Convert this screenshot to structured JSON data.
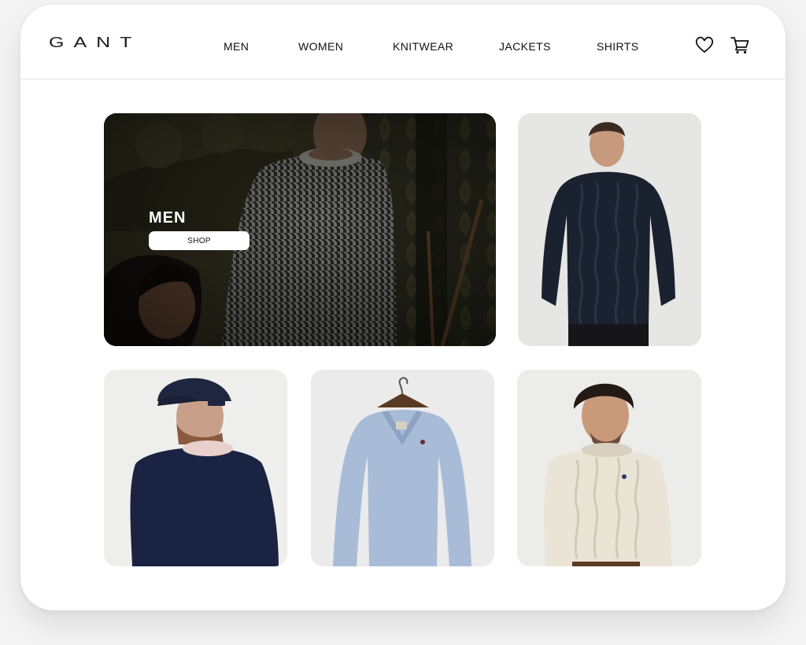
{
  "brand": {
    "logo": "GANT"
  },
  "nav": {
    "items": [
      "MEN",
      "WOMEN",
      "KNITWEAR",
      "JACKETS",
      "SHIRTS"
    ]
  },
  "header_icons": [
    "heart-icon",
    "cart-icon"
  ],
  "hero": {
    "title": "MEN",
    "button_label": "SHOP"
  },
  "products": [
    {
      "image": "man-back-dark-cable-knit-sweater"
    },
    {
      "image": "man-navy-sweater-with-cap"
    },
    {
      "image": "light-blue-v-neck-sweater-on-hanger"
    },
    {
      "image": "man-cream-cable-knit-sweater"
    }
  ],
  "colors": {
    "background": "#ffffff",
    "text": "#111111",
    "hero_overlay": "#2a2a22",
    "button": "#ffffff"
  }
}
